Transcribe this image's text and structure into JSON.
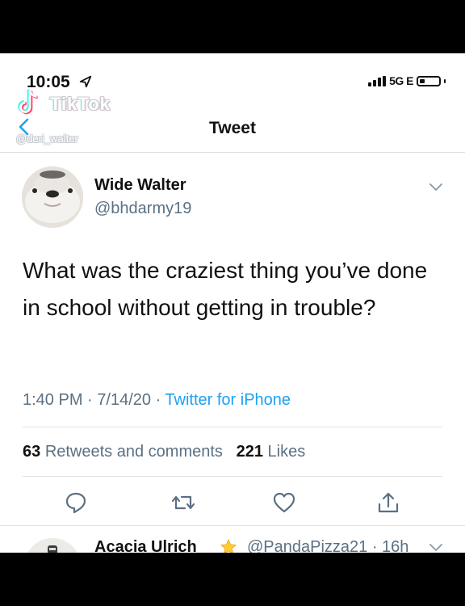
{
  "status_bar": {
    "time": "10:05",
    "network": "5G E"
  },
  "watermark": {
    "brand": "TikTok",
    "handle": "@deri_walter"
  },
  "nav": {
    "title": "Tweet"
  },
  "tweet": {
    "author_name": "Wide Walter",
    "author_handle": "@bhdarmy19",
    "text": "What was the craziest thing you’ve done in school without getting in trouble?",
    "time": "1:40 PM",
    "date": "7/14/20",
    "source": "Twitter for iPhone",
    "retweets_count": "63",
    "retweets_label": "Retweets and comments",
    "likes_count": "221",
    "likes_label": "Likes"
  },
  "actions": [
    {
      "icon": "reply-icon"
    },
    {
      "icon": "retweet-icon"
    },
    {
      "icon": "like-heart-icon"
    },
    {
      "icon": "share-icon"
    }
  ],
  "next_reply": {
    "author_name": "Acacia Ulrich",
    "handle_time": "@PandaPizza21 · 16h"
  },
  "colors": {
    "link": "#1da1f2",
    "secondary_text": "#5b7083",
    "separator": "#dfe3e6"
  }
}
